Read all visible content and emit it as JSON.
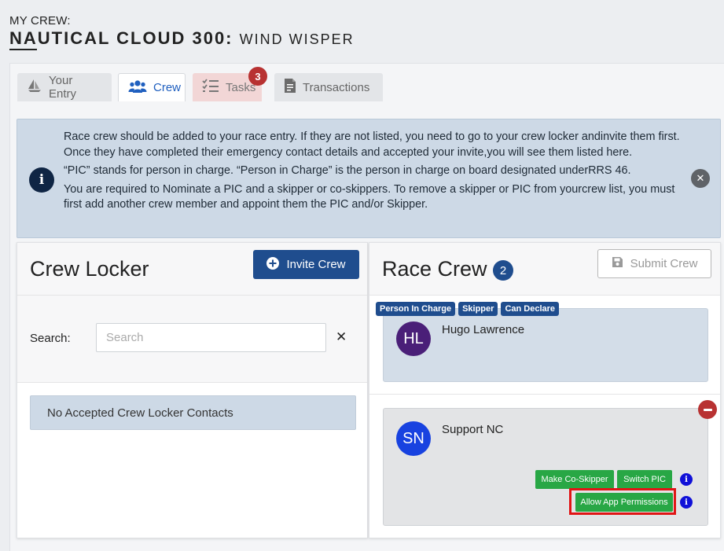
{
  "header": {
    "crew_label": "MY CREW:",
    "event_title": "NAUTICAL CLOUD 300:",
    "boat_name": "WIND WISPER"
  },
  "tabs": [
    {
      "label": "Your Entry",
      "icon": "sailboat-icon"
    },
    {
      "label": "Crew",
      "icon": "users-icon"
    },
    {
      "label": "Tasks",
      "icon": "task-list-icon",
      "badge": "3"
    },
    {
      "label": "Transactions",
      "icon": "receipt-icon"
    }
  ],
  "info": {
    "paragraphs": [
      "Race crew should be added to your race entry. If they are not listed, you need to go to your crew locker andinvite them first. Once they have completed their emergency contact details and accepted your invite,you will see them listed here.",
      "“PIC” stands for person in charge. “Person in Charge” is the person in charge on board designated underRRS 46.",
      "You are required to Nominate a PIC and a skipper or co-skippers. To remove a skipper or PIC from yourcrew list, you must first add another crew member and appoint them the PIC and/or Skipper."
    ],
    "icon_glyph": "i",
    "close_glyph": "✕"
  },
  "crew_locker": {
    "title": "Crew Locker",
    "invite_label": "Invite Crew",
    "search_label": "Search:",
    "search_placeholder": "Search",
    "search_value": "",
    "clear_glyph": "✕",
    "empty_message": "No Accepted Crew Locker Contacts"
  },
  "race_crew": {
    "title": "Race Crew",
    "count": "2",
    "submit_label": "Submit Crew",
    "members": [
      {
        "initials": "HL",
        "name": "Hugo Lawrence",
        "tags": [
          "Person In Charge",
          "Skipper",
          "Can Declare"
        ],
        "avatar_color": "#4a1f78"
      },
      {
        "initials": "SN",
        "name": "Support NC",
        "actions": [
          "Make Co-Skipper",
          "Switch PIC",
          "Allow App Permissions"
        ],
        "avatar_color": "#1842e0"
      }
    ],
    "info_glyph": "i"
  },
  "colors": {
    "primary": "#1f4d8e",
    "success": "#28a745",
    "danger": "#b83232",
    "info_bg": "#cdd9e6",
    "highlight": "#e01515"
  }
}
